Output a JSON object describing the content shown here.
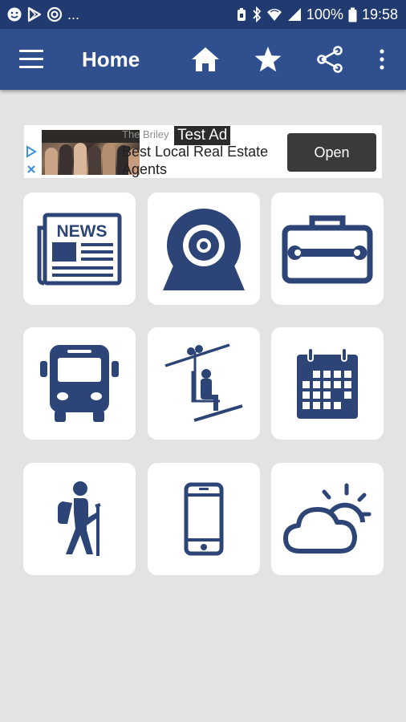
{
  "status_bar": {
    "battery": "100%",
    "time": "19:58",
    "ellipsis": "...",
    "left_icons": [
      "face-icon",
      "play-store-icon",
      "target-icon"
    ],
    "right_icons": [
      "battery-saver-icon",
      "bluetooth-icon",
      "wifi-icon",
      "signal-icon",
      "battery-icon"
    ]
  },
  "app_bar": {
    "title": "Home",
    "actions": [
      "home-icon",
      "star-icon",
      "share-icon",
      "more-icon"
    ],
    "color": "#2f4f8f"
  },
  "ad": {
    "label": "Test Ad",
    "brand": "The Briley",
    "headline": "Best Local Real Estate Agents",
    "button": "Open"
  },
  "tiles": [
    {
      "icon": "news-icon"
    },
    {
      "icon": "webcam-icon"
    },
    {
      "icon": "toolbox-icon"
    },
    {
      "icon": "bus-icon"
    },
    {
      "icon": "ski-lift-icon"
    },
    {
      "icon": "calendar-icon"
    },
    {
      "icon": "hiker-icon"
    },
    {
      "icon": "phone-icon"
    },
    {
      "icon": "weather-icon"
    }
  ],
  "colors": {
    "icon": "#2c4476",
    "background": "#e3e3e3",
    "status_bar": "#213a70"
  }
}
